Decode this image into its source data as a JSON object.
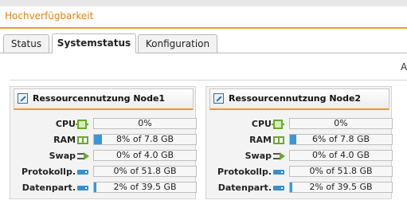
{
  "app": {
    "title": "Hochverfügbarkeit"
  },
  "tabs": [
    {
      "label": "Status",
      "active": false
    },
    {
      "label": "Systemstatus",
      "active": true
    },
    {
      "label": "Konfiguration",
      "active": false
    }
  ],
  "edge_letter": "A",
  "nodes": [
    {
      "title": "Ressourcennutzung Node1",
      "rows": [
        {
          "label": "CPU",
          "icon": "cpu-icon",
          "value": "0%",
          "fraction": 0.0
        },
        {
          "label": "RAM",
          "icon": "ram-icon",
          "value": "8% of 7.8 GB",
          "fraction": 0.08
        },
        {
          "label": "Swap",
          "icon": "swap-icon",
          "value": "0% of 4.0 GB",
          "fraction": 0.0
        },
        {
          "label": "Protokollp.",
          "icon": "disk-icon",
          "value": "0% of 51.8 GB",
          "fraction": 0.0
        },
        {
          "label": "Datenpart.",
          "icon": "disk-icon",
          "value": "2% of 39.5 GB",
          "fraction": 0.02
        }
      ]
    },
    {
      "title": "Ressourcennutzung Node2",
      "rows": [
        {
          "label": "CPU",
          "icon": "cpu-icon",
          "value": "0%",
          "fraction": 0.0
        },
        {
          "label": "RAM",
          "icon": "ram-icon",
          "value": "6% of 7.8 GB",
          "fraction": 0.06
        },
        {
          "label": "Swap",
          "icon": "swap-icon",
          "value": "0% of 4.0 GB",
          "fraction": 0.0
        },
        {
          "label": "Protokollp.",
          "icon": "disk-icon",
          "value": "0% of 51.8 GB",
          "fraction": 0.0
        },
        {
          "label": "Datenpart.",
          "icon": "disk-icon",
          "value": "2% of 39.5 GB",
          "fraction": 0.02
        }
      ]
    }
  ],
  "colors": {
    "accent": "#f29a1f",
    "title_text": "#e67e12",
    "bar_fill": "#3a96d8",
    "icon_green": "#6aaa2c"
  }
}
